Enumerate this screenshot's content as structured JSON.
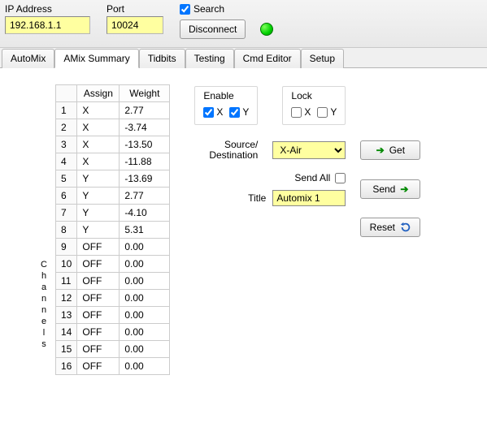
{
  "header": {
    "ip_label": "IP Address",
    "ip_value": "192.168.1.1",
    "port_label": "Port",
    "port_value": "10024",
    "search_label": "Search",
    "search_checked": true,
    "connect_button": "Disconnect",
    "status_color": "#00d100"
  },
  "tabs": [
    {
      "label": "AutoMix"
    },
    {
      "label": "AMix Summary"
    },
    {
      "label": "Tidbits"
    },
    {
      "label": "Testing"
    },
    {
      "label": "Cmd Editor"
    },
    {
      "label": "Setup"
    }
  ],
  "active_tab_index": 1,
  "channels_label": "Channels",
  "channels_headers": {
    "num": "",
    "assign": "Assign",
    "weight": "Weight"
  },
  "channels": [
    {
      "n": "1",
      "assign": "X",
      "weight": "2.77"
    },
    {
      "n": "2",
      "assign": "X",
      "weight": "-3.74"
    },
    {
      "n": "3",
      "assign": "X",
      "weight": "-13.50"
    },
    {
      "n": "4",
      "assign": "X",
      "weight": "-11.88"
    },
    {
      "n": "5",
      "assign": "Y",
      "weight": "-13.69"
    },
    {
      "n": "6",
      "assign": "Y",
      "weight": "2.77"
    },
    {
      "n": "7",
      "assign": "Y",
      "weight": "-4.10"
    },
    {
      "n": "8",
      "assign": "Y",
      "weight": "5.31"
    },
    {
      "n": "9",
      "assign": "OFF",
      "weight": "0.00"
    },
    {
      "n": "10",
      "assign": "OFF",
      "weight": "0.00"
    },
    {
      "n": "11",
      "assign": "OFF",
      "weight": "0.00"
    },
    {
      "n": "12",
      "assign": "OFF",
      "weight": "0.00"
    },
    {
      "n": "13",
      "assign": "OFF",
      "weight": "0.00"
    },
    {
      "n": "14",
      "assign": "OFF",
      "weight": "0.00"
    },
    {
      "n": "15",
      "assign": "OFF",
      "weight": "0.00"
    },
    {
      "n": "16",
      "assign": "OFF",
      "weight": "0.00"
    }
  ],
  "enable_group": {
    "title": "Enable",
    "x": "X",
    "y": "Y",
    "x_checked": true,
    "y_checked": true
  },
  "lock_group": {
    "title": "Lock",
    "x": "X",
    "y": "Y",
    "x_checked": false,
    "y_checked": false
  },
  "source_label": "Source/ Destination",
  "source_value": "X-Air",
  "get_button": "Get",
  "send_all_label": "Send All",
  "send_all_checked": false,
  "title_label": "Title",
  "title_value": "Automix 1",
  "send_button": "Send",
  "reset_button": "Reset"
}
